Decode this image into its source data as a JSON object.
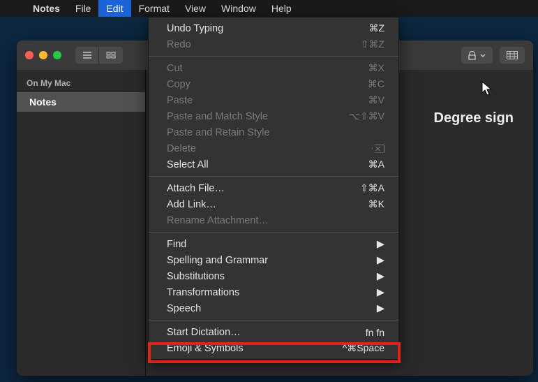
{
  "menubar": {
    "app": "Notes",
    "items": [
      "File",
      "Edit",
      "Format",
      "View",
      "Window",
      "Help"
    ],
    "open_index": 1
  },
  "sidebar": {
    "header": "On My Mac",
    "items": [
      {
        "label": "Notes",
        "selected": true
      }
    ]
  },
  "note": {
    "title": "Degree sign"
  },
  "dropdown": {
    "items": [
      {
        "label": "Undo Typing",
        "shortcut": "⌘Z",
        "disabled": false
      },
      {
        "label": "Redo",
        "shortcut": "⇧⌘Z",
        "disabled": true
      },
      {
        "sep": true
      },
      {
        "label": "Cut",
        "shortcut": "⌘X",
        "disabled": true
      },
      {
        "label": "Copy",
        "shortcut": "⌘C",
        "disabled": true
      },
      {
        "label": "Paste",
        "shortcut": "⌘V",
        "disabled": true
      },
      {
        "label": "Paste and Match Style",
        "shortcut": "⌥⇧⌘V",
        "disabled": true
      },
      {
        "label": "Paste and Retain Style",
        "shortcut": "",
        "disabled": true
      },
      {
        "label": "Delete",
        "shortcut": "",
        "disabled": true,
        "del_icon": true
      },
      {
        "label": "Select All",
        "shortcut": "⌘A",
        "disabled": false
      },
      {
        "sep": true
      },
      {
        "label": "Attach File…",
        "shortcut": "⇧⌘A",
        "disabled": false
      },
      {
        "label": "Add Link…",
        "shortcut": "⌘K",
        "disabled": false
      },
      {
        "label": "Rename Attachment…",
        "shortcut": "",
        "disabled": true
      },
      {
        "sep": true
      },
      {
        "label": "Find",
        "submenu": true,
        "disabled": false
      },
      {
        "label": "Spelling and Grammar",
        "submenu": true,
        "disabled": false
      },
      {
        "label": "Substitutions",
        "submenu": true,
        "disabled": false
      },
      {
        "label": "Transformations",
        "submenu": true,
        "disabled": false
      },
      {
        "label": "Speech",
        "submenu": true,
        "disabled": false
      },
      {
        "sep": true
      },
      {
        "label": "Start Dictation…",
        "shortcut": "fn fn",
        "disabled": false
      },
      {
        "label": "Emoji & Symbols",
        "shortcut": "^⌘Space",
        "disabled": false,
        "highlighted": true
      }
    ]
  }
}
